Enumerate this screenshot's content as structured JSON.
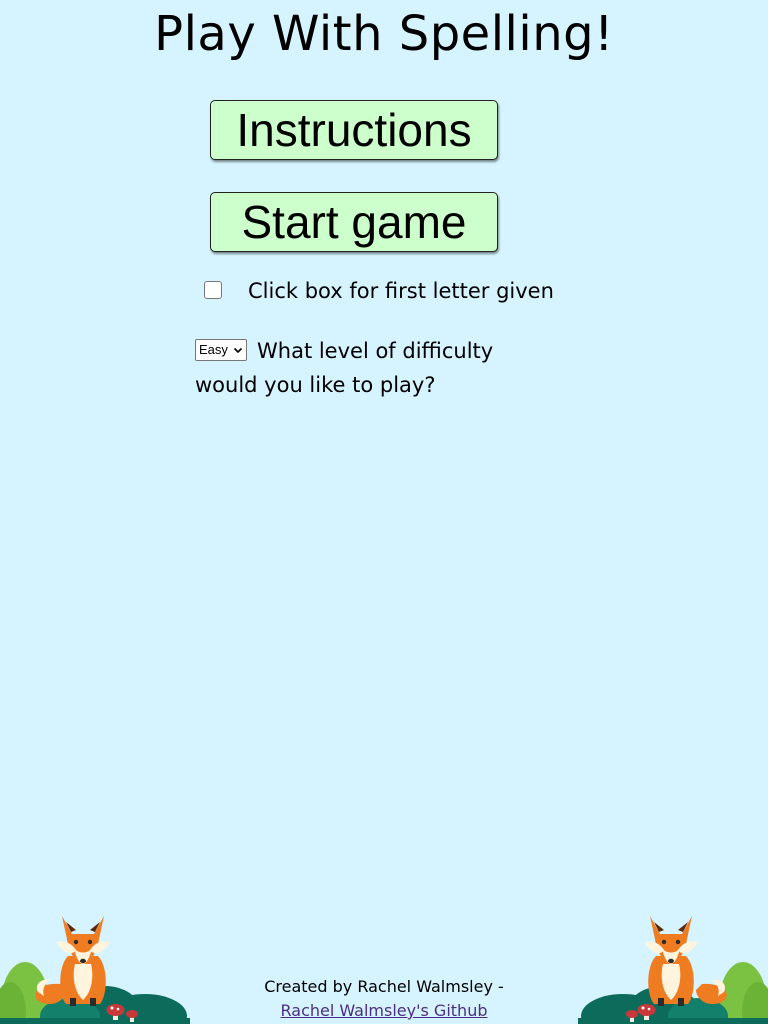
{
  "header": {
    "title": "Play With Spelling!"
  },
  "buttons": {
    "instructions_label": "Instructions",
    "start_label": "Start game"
  },
  "options": {
    "first_letter_label": "Click box for first letter given",
    "first_letter_checked": false,
    "difficulty_selected": "Easy",
    "difficulty_label": "What level of difficulty would you like to play?"
  },
  "footer": {
    "credit_text": "Created by Rachel Walmsley -",
    "github_link_text": "Rachel Walmsley's Github"
  },
  "colors": {
    "background": "#d6f4ff",
    "button_fill": "#ccffcc",
    "link": "#4b2e83",
    "fox_orange": "#f07c22",
    "bush_dark": "#0c6b5b",
    "bush_light": "#7cc242"
  },
  "icons": {
    "left_decoration": "fox-sitting-in-bushes-icon",
    "right_decoration": "fox-sitting-in-bushes-icon"
  }
}
